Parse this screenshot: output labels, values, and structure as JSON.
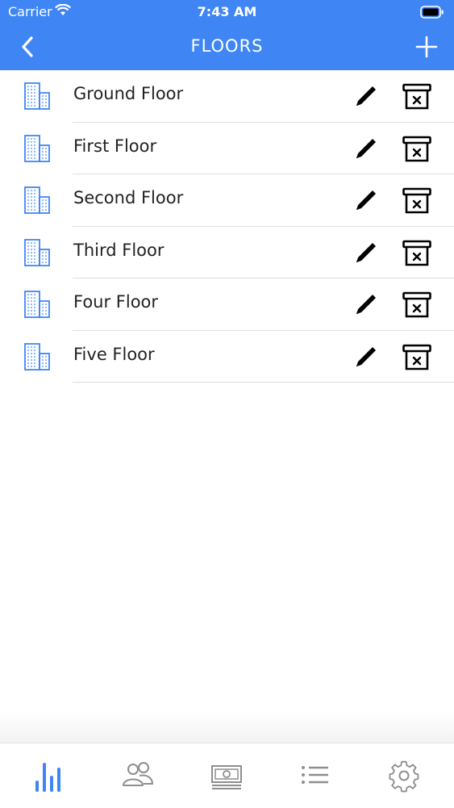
{
  "status_bar": {
    "carrier": "Carrier",
    "time": "7:43 AM"
  },
  "header": {
    "title": "FLOORS",
    "back_icon": "chevron-left-icon",
    "add_icon": "plus-icon"
  },
  "floors": [
    {
      "label": "Ground Floor"
    },
    {
      "label": "First Floor"
    },
    {
      "label": "Second Floor"
    },
    {
      "label": "Third Floor"
    },
    {
      "label": "Four Floor"
    },
    {
      "label": "Five Floor"
    }
  ],
  "row_icons": {
    "building": "building-icon",
    "edit": "pencil-icon",
    "delete": "trash-x-icon"
  },
  "tabs": [
    {
      "icon": "bar-chart-icon",
      "active": true
    },
    {
      "icon": "users-icon",
      "active": false
    },
    {
      "icon": "money-icon",
      "active": false
    },
    {
      "icon": "list-icon",
      "active": false
    },
    {
      "icon": "gear-icon",
      "active": false
    }
  ],
  "colors": {
    "accent": "#3f86f4",
    "active_tab": "#3f86f4",
    "inactive_tab": "#8e8e8e",
    "text": "#222222"
  }
}
